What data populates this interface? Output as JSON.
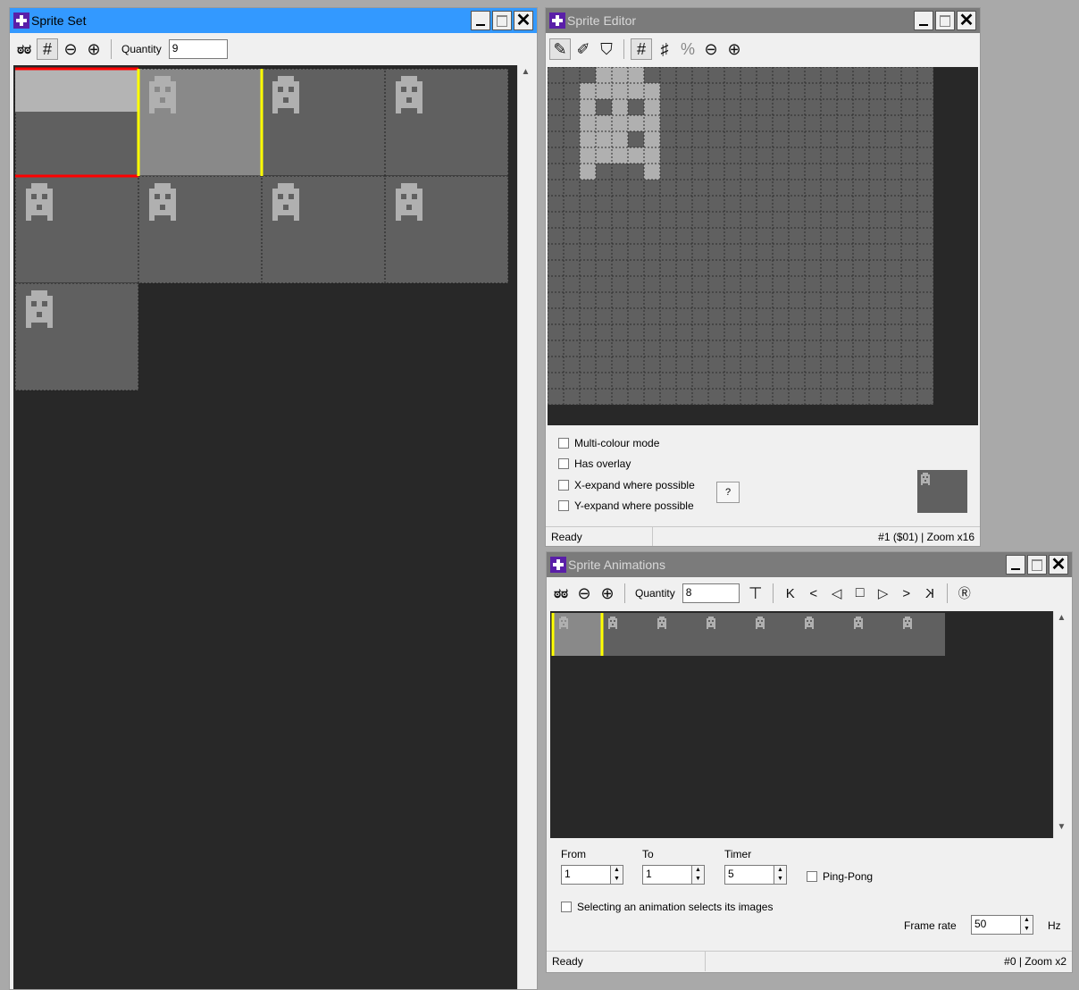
{
  "sprite_set": {
    "title": "Sprite Set",
    "quantity_label": "Quantity",
    "quantity_value": "9",
    "tools": [
      "glasses-icon",
      "grid-icon",
      "zoom-out-icon",
      "zoom-in-icon"
    ]
  },
  "sprite_editor": {
    "title": "Sprite Editor",
    "tools": [
      "pencil-icon",
      "pencil-plus-icon",
      "fill-icon",
      "grid-icon",
      "fine-grid-icon",
      "percent-grid-icon",
      "zoom-out-icon",
      "zoom-in-icon"
    ],
    "options": [
      "Multi-colour mode",
      "Has overlay",
      "X-expand where possible",
      "Y-expand where possible"
    ],
    "help_label": "?",
    "status_left": "Ready",
    "status_right": "#1 ($01) | Zoom x16"
  },
  "sprite_animations": {
    "title": "Sprite Animations",
    "quantity_label": "Quantity",
    "quantity_value": "8",
    "from_label": "From",
    "to_label": "To",
    "timer_label": "Timer",
    "from_value": "1",
    "to_value": "1",
    "timer_value": "5",
    "pingpong_label": "Ping-Pong",
    "select_anim_label": "Selecting an animation selects its images",
    "framerate_label": "Frame rate",
    "framerate_value": "50",
    "hz_label": "Hz",
    "status_left": "Ready",
    "status_right": "#0 | Zoom x2",
    "playback": [
      "K",
      "<",
      "◁",
      "□",
      "▷",
      ">",
      "K"
    ]
  },
  "colors": {
    "active_title": "#3399ff",
    "inactive_title": "#7b7b7b",
    "canvas_bg": "#282828",
    "cell_bg": "#606060",
    "sprite_pixel": "#b0b0b0",
    "selection_red": "#ff0000",
    "selection_yellow": "#ffff00"
  }
}
